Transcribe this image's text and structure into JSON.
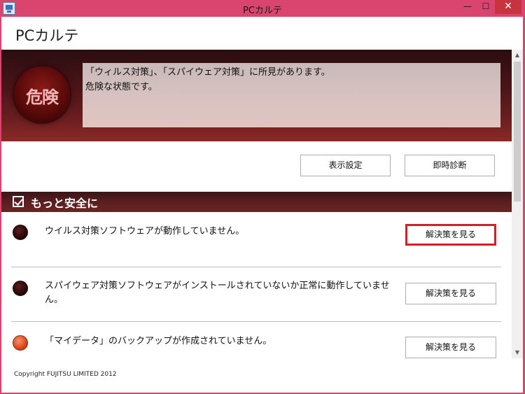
{
  "window": {
    "title": "PCカルテ",
    "minimize_glyph": "—",
    "maximize_glyph": "☐",
    "close_glyph": "✕"
  },
  "app": {
    "title": "PCカルテ"
  },
  "status": {
    "badge_label": "危険",
    "message_line1": "「ウィルス対策」、「スパイウェア対策」に所見があります。",
    "message_line2": "危険な状態です。"
  },
  "actions": {
    "display_settings": "表示設定",
    "instant_diagnosis": "即時診断"
  },
  "section": {
    "title": "もっと安全に"
  },
  "issues": [
    {
      "text": "ウイルス対策ソフトウェアが動作していません。",
      "button": "解決策を見る",
      "severity": "danger"
    },
    {
      "text": "スパイウェア対策ソフトウェアがインストールされていないか正常に動作していません。",
      "button": "解決策を見る",
      "severity": "danger"
    },
    {
      "text": "「マイデータ」のバックアップが作成されていません。",
      "button": "解決策を見る",
      "severity": "warning"
    }
  ],
  "footer": {
    "copyright": "Copyright FUJITSU LIMITED 2012"
  },
  "colors": {
    "window_frame": "#d9456e",
    "banner_dark": "#4a1418",
    "danger_dot": "#2a0606",
    "warning_dot": "#e04a20",
    "highlight": "#d0202a"
  }
}
